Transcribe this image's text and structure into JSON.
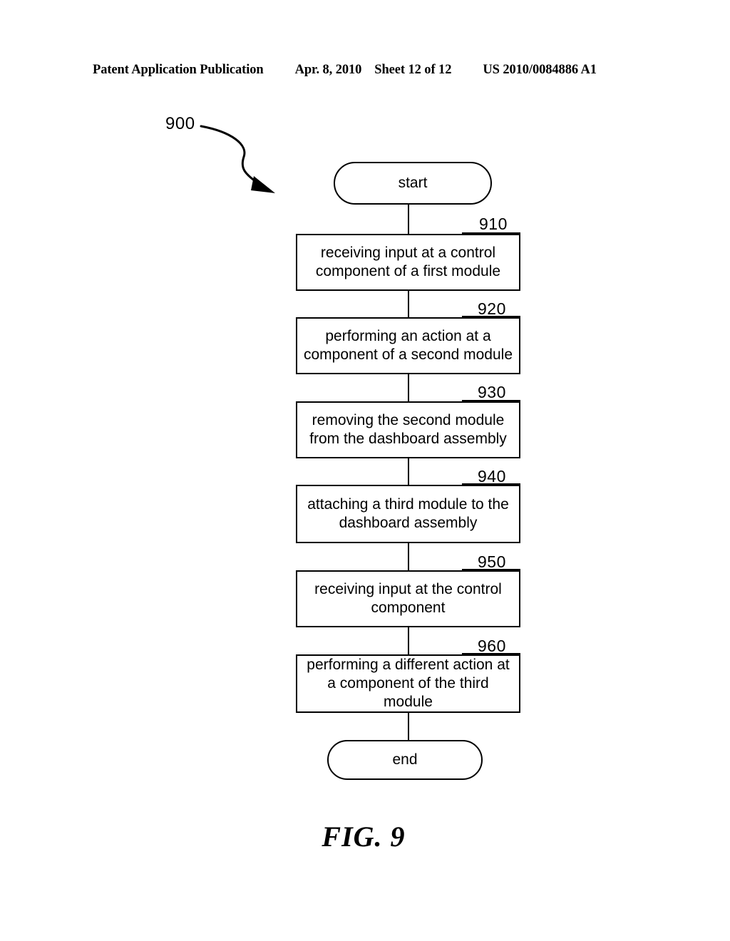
{
  "header": {
    "publication": "Patent Application Publication",
    "date": "Apr. 8, 2010",
    "sheet": "Sheet 12 of 12",
    "pub_number": "US 2010/0084886 A1"
  },
  "figure": {
    "caption": "FIG. 9",
    "callout_number": "900"
  },
  "flowchart": {
    "start_label": "start",
    "end_label": "end",
    "steps": [
      {
        "ref": "910",
        "text": "receiving input at a control component of a first module"
      },
      {
        "ref": "920",
        "text": "performing an action at a component of a second module"
      },
      {
        "ref": "930",
        "text": "removing the second module from the dashboard assembly"
      },
      {
        "ref": "940",
        "text": "attaching a third module to the dashboard assembly"
      },
      {
        "ref": "950",
        "text": "receiving input at the control component"
      },
      {
        "ref": "960",
        "text": "performing a different action at a component of the third module"
      }
    ]
  },
  "colors": {
    "ink": "#000000",
    "paper": "#ffffff"
  }
}
